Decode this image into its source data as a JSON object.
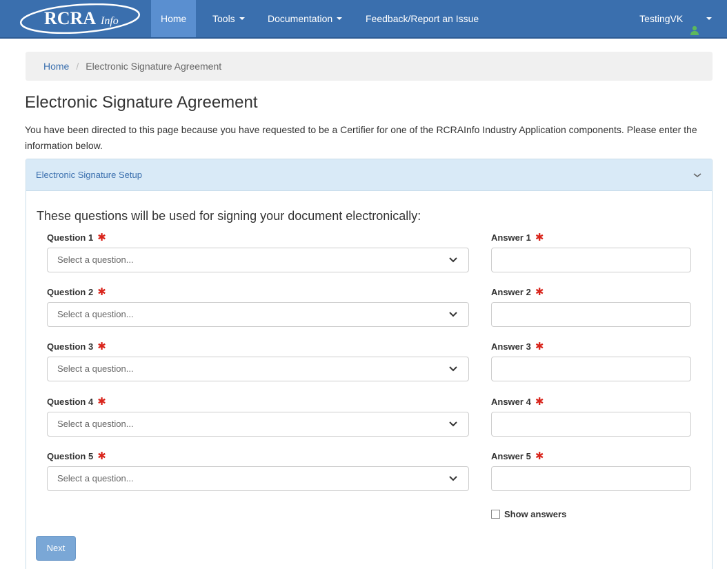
{
  "brand": {
    "logo_text": "RCRAInfo"
  },
  "nav": {
    "items": [
      {
        "label": "Home",
        "active": true,
        "dropdown": false
      },
      {
        "label": "Tools",
        "active": false,
        "dropdown": true
      },
      {
        "label": "Documentation",
        "active": false,
        "dropdown": true
      },
      {
        "label": "Feedback/Report an Issue",
        "active": false,
        "dropdown": false
      }
    ],
    "user": {
      "name": "TestingVK",
      "icon": "user-icon"
    }
  },
  "breadcrumb": {
    "home": "Home",
    "separator": "/",
    "current": "Electronic Signature Agreement"
  },
  "page": {
    "title": "Electronic Signature Agreement",
    "intro": "You have been directed to this page because you have requested to be a Certifier for one of the RCRAInfo Industry Application components. Please enter the information below."
  },
  "panel": {
    "heading": "Electronic Signature Setup",
    "subtitle": "These questions will be used for signing your document electronically:",
    "required_marker": "✱",
    "questions": [
      {
        "label": "Question 1",
        "placeholder": "Select a question..."
      },
      {
        "label": "Question 2",
        "placeholder": "Select a question..."
      },
      {
        "label": "Question 3",
        "placeholder": "Select a question..."
      },
      {
        "label": "Question 4",
        "placeholder": "Select a question..."
      },
      {
        "label": "Question 5",
        "placeholder": "Select a question..."
      }
    ],
    "answers": [
      {
        "label": "Answer 1",
        "value": ""
      },
      {
        "label": "Answer 2",
        "value": ""
      },
      {
        "label": "Answer 3",
        "value": ""
      },
      {
        "label": "Answer 4",
        "value": ""
      },
      {
        "label": "Answer 5",
        "value": ""
      }
    ],
    "show_answers_label": "Show answers",
    "show_answers_checked": false,
    "next_label": "Next"
  },
  "colors": {
    "navbar": "#3a6fae",
    "nav_active": "#5a8fd0",
    "panel_heading": "#d9eaf7",
    "required": "#d9251c",
    "button": "#7aa7d6",
    "user_icon": "#5cb85c"
  }
}
